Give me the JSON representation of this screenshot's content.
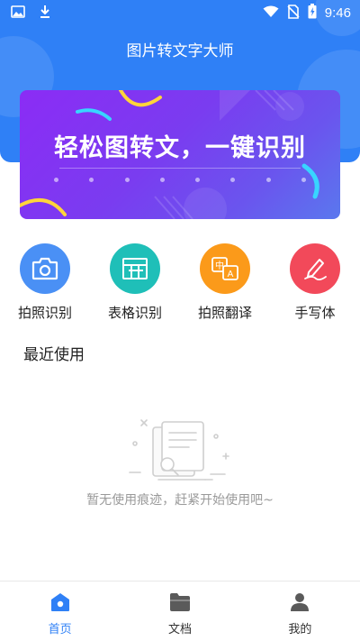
{
  "status_bar": {
    "time": "9:46"
  },
  "app": {
    "title": "图片转文字大师"
  },
  "banner": {
    "title": "轻松图转文，一键识别"
  },
  "features": [
    {
      "label": "拍照识别",
      "icon": "camera-icon",
      "color": "#4a90f5"
    },
    {
      "label": "表格识别",
      "icon": "table-icon",
      "color": "#1fbfb8"
    },
    {
      "label": "拍照翻译",
      "icon": "translate-icon",
      "color": "#fb9a1a"
    },
    {
      "label": "手写体",
      "icon": "pen-icon",
      "color": "#f2495a"
    }
  ],
  "recent": {
    "title": "最近使用",
    "empty_text": "暂无使用痕迹，赶紧开始使用吧~"
  },
  "bottom_nav": [
    {
      "label": "首页",
      "icon": "home-icon",
      "active": true
    },
    {
      "label": "文档",
      "icon": "folder-icon",
      "active": false
    },
    {
      "label": "我的",
      "icon": "user-icon",
      "active": false
    }
  ],
  "colors": {
    "primary": "#2f80f6",
    "active_nav": "#2f80f6"
  }
}
